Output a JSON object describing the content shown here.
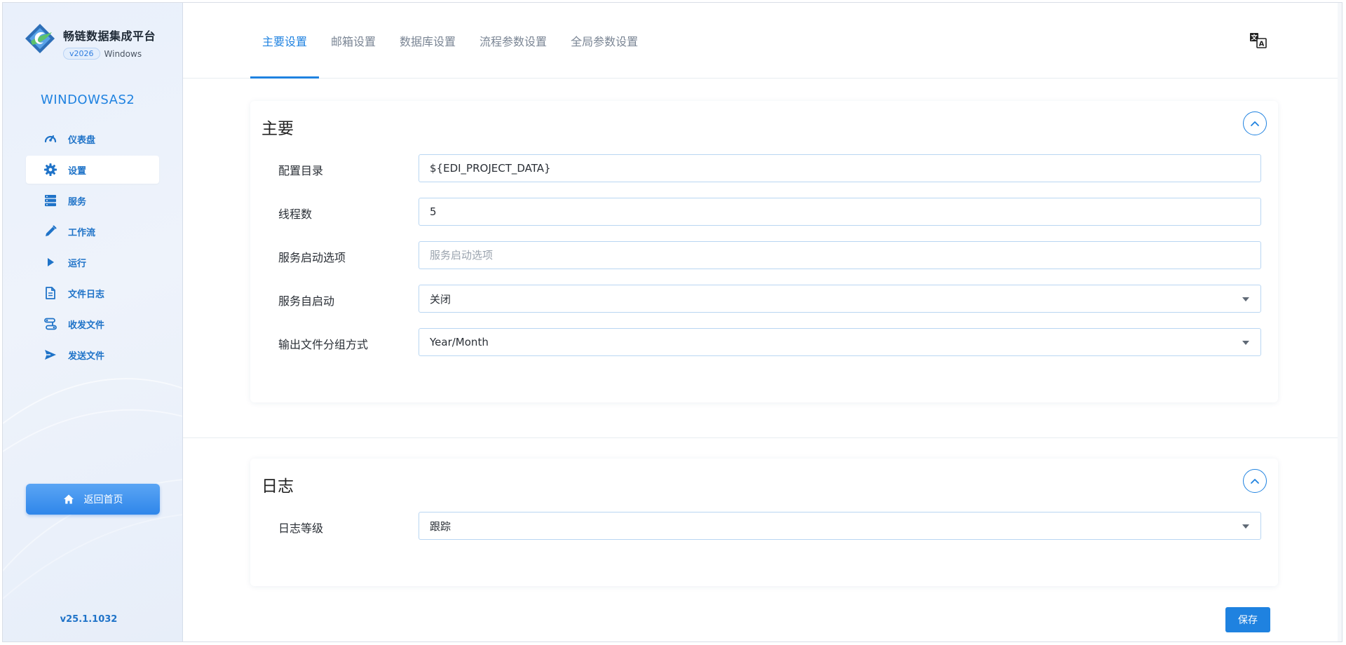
{
  "brand": {
    "title": "畅链数据集成平台",
    "version_badge": "v2026",
    "platform": "Windows"
  },
  "project_name": "WINDOWSAS2",
  "sidebar": {
    "items": [
      {
        "label": "仪表盘",
        "icon": "dashboard-gauge-icon"
      },
      {
        "label": "设置",
        "icon": "gear-icon",
        "active": true
      },
      {
        "label": "服务",
        "icon": "server-icon"
      },
      {
        "label": "工作流",
        "icon": "pencil-icon"
      },
      {
        "label": "运行",
        "icon": "play-icon"
      },
      {
        "label": "文件日志",
        "icon": "document-icon"
      },
      {
        "label": "收发文件",
        "icon": "route-icon"
      },
      {
        "label": "发送文件",
        "icon": "send-icon"
      }
    ],
    "home_button": "返回首页",
    "version": "v25.1.1032"
  },
  "tabs": [
    {
      "label": "主要设置",
      "active": true
    },
    {
      "label": "邮箱设置"
    },
    {
      "label": "数据库设置"
    },
    {
      "label": "流程参数设置"
    },
    {
      "label": "全局参数设置"
    }
  ],
  "main_section": {
    "title": "主要",
    "fields": {
      "config_dir": {
        "label": "配置目录",
        "value": "${EDI_PROJECT_DATA}"
      },
      "threads": {
        "label": "线程数",
        "value": "5"
      },
      "service_options": {
        "label": "服务启动选项",
        "value": "",
        "placeholder": "服务启动选项"
      },
      "auto_start": {
        "label": "服务自启动",
        "value": "关闭"
      },
      "output_grouping": {
        "label": "输出文件分组方式",
        "value": "Year/Month"
      }
    }
  },
  "log_section": {
    "title": "日志",
    "fields": {
      "log_level": {
        "label": "日志等级",
        "value": "跟踪"
      }
    }
  },
  "save_label": "保存",
  "colors": {
    "accent": "#1f82e0",
    "sidebar_bg": "#eaf1fb",
    "nav_text": "#1f73c8"
  }
}
